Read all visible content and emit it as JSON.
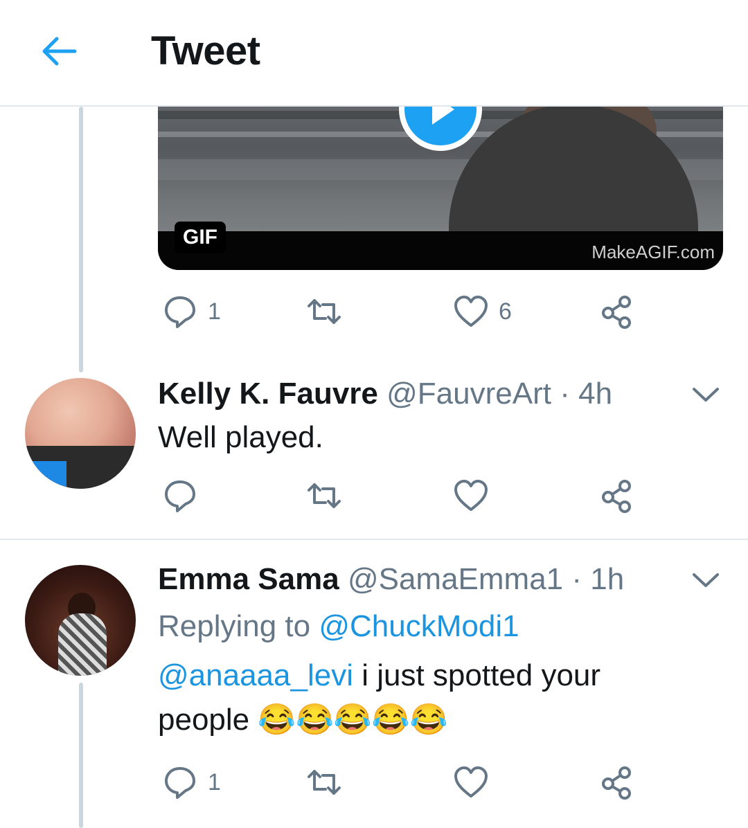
{
  "header": {
    "title": "Tweet"
  },
  "gif_card": {
    "badge": "GIF",
    "watermark": "MakeAGIF.com"
  },
  "first_actions": {
    "reply_count": "1",
    "retweet_count": "",
    "like_count": "6"
  },
  "reply1": {
    "name": "Kelly K. Fauvre",
    "handle": "@FauvreArt",
    "dot": " · ",
    "time": "4h",
    "text": "Well played."
  },
  "reply2": {
    "name": "Emma Sama",
    "handle": "@SamaEmma1",
    "dot": " · ",
    "time": "1h",
    "replying_label": "Replying to ",
    "replying_handle": "@ChuckModi1",
    "mention": "@anaaaa_levi",
    "text": " i just spotted your people ",
    "emoji": "😂😂😂😂😂",
    "reply_count": "1"
  },
  "colors": {
    "accent": "#1da1f2",
    "secondary_text": "#657786",
    "divider": "#e1e8ed"
  }
}
